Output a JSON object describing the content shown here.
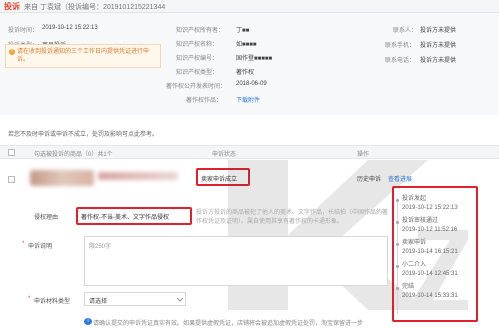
{
  "header": {
    "title": "投诉",
    "subtitle": "来自 丁袁斌（投诉编号：2019101215221344"
  },
  "info": {
    "complaint_time_label": "投诉时间：",
    "complaint_time_value": "2019-10-12 15:22:13",
    "complaint_type_label": "投诉类型：",
    "complaint_type_value": "商品投诉",
    "owner_label": "知识产权所有者：",
    "owner_value": "丁■■",
    "ip_name_label": "知识产权名称：",
    "ip_name_value": "如■■■■",
    "ip_number_label": "知识产权编号：",
    "ip_number_value": "国作登■■■■■",
    "ip_type_label": "知识产权类型：",
    "ip_type_value": "著作权",
    "publish_label": "著作权公开发表时间：",
    "publish_value": "2018-06-09",
    "attachment_label": "著作权作品：",
    "attachment_link": "下载附件",
    "contact_label": "联系人：",
    "contact_value": "投诉方未提供",
    "phone_label": "联系手机：",
    "phone_value": "投诉方未提供",
    "tel_label": "联系电话：",
    "tel_value": "投诉方未提供",
    "warning": "请在收到投诉通知的三个工作日内提供凭证进行申诉。"
  },
  "notice": "若您不及时申诉或申诉不成立，处罚及影响可点此参考。",
  "table": {
    "col_goods": "勾选被投诉的商品（0）共1个",
    "col_status": "申诉状态",
    "col_action": "操作",
    "status": "卖家申诉成立",
    "action_history": "历史申诉",
    "action_progress": "查看进展"
  },
  "reason": {
    "label": "侵权理由",
    "value": "著作权-不当-美术、文字作品侵权",
    "desc": "投诉方投诉的商品被犯了他人的美术、文字作品，长结拍（中国作品的著作权凭证及证明）。属自使用其享有著作权的卡通形象。"
  },
  "form": {
    "explain_label": "申诉说明",
    "explain_placeholder": "限250字",
    "material_label": "申诉材料类型",
    "material_select": "请选择",
    "tip": "请确认提交的申诉凭证真实有效。如果提供虚假凭证，店铺将会被追加虚假凭证处罚，淘宝保留进一步"
  },
  "timeline": [
    {
      "title": "投诉发起",
      "time": "2019-10-12 15:22:13"
    },
    {
      "title": "投诉审核通过",
      "time": "2019-10-12 11:52:16"
    },
    {
      "title": "卖家申诉",
      "time": "2019-10-14 16:15:21"
    },
    {
      "title": "小二介入",
      "time": "2019-10-14 12:45:31"
    },
    {
      "title": "完结",
      "time": "2019-10-14 15:33:31"
    }
  ],
  "colors": {
    "accent": "#e2472f",
    "highlight": "#e0202c",
    "link": "#2f7be6"
  }
}
